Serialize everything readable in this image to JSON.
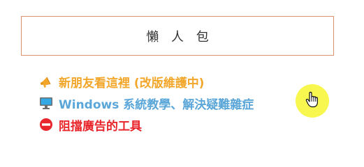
{
  "widget": {
    "title": "懶 人 包",
    "border_color": "#d9926d"
  },
  "links": [
    {
      "label": "新朋友看這裡 (改版維護中)",
      "icon": "megaphone-icon",
      "color": "#f2a72b"
    },
    {
      "label": "Windows 系統教學、解決疑難雜症",
      "icon": "computer-monitor-icon",
      "color": "#5aa6d8"
    },
    {
      "label": "阻擋廣告的工具",
      "icon": "no-entry-icon",
      "color": "#e8262b"
    }
  ],
  "cursor": {
    "icon": "hand-pointer-icon",
    "highlight_color": "#f5f528"
  }
}
